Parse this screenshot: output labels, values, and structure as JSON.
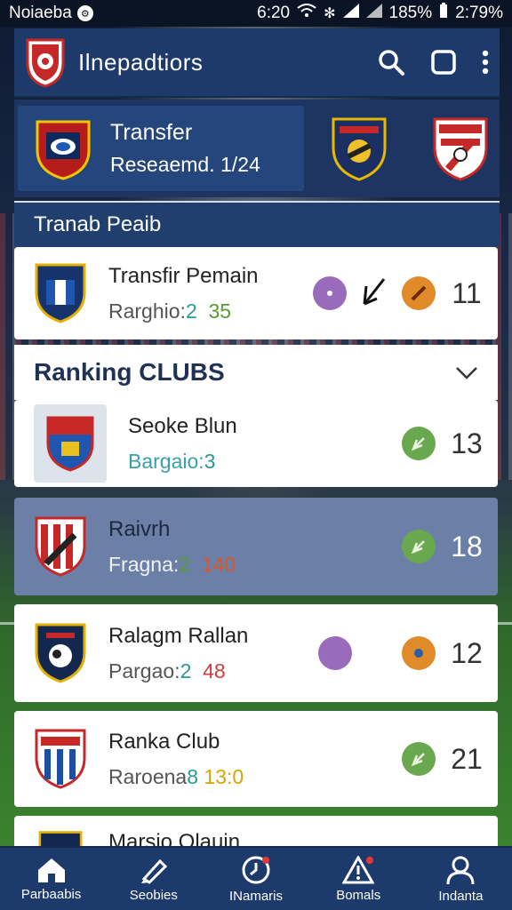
{
  "status_bar": {
    "carrier": "Noiaeba",
    "time": "6:20",
    "battery": "185%",
    "clock2": "2:79%"
  },
  "app_bar": {
    "title": "Ilnepadtiors",
    "icons": [
      "search-icon",
      "square-icon",
      "more-vert-icon"
    ]
  },
  "banner": {
    "title": "Transfer",
    "subtitle": "Reseaemd. 1/24"
  },
  "section": {
    "title": "Tranab Peaib"
  },
  "transfer_item": {
    "name": "Transfir Pemain",
    "sub_prefix": "Rarghio:",
    "sub_num1": "2",
    "sub_num2": "35",
    "rank": "11"
  },
  "ranking": {
    "title": "Ranking CLUBS",
    "items": [
      {
        "name": "Seoke Blun",
        "sub_prefix": "Bargaio:",
        "sub_num1": "3",
        "sub_num2": "",
        "rank": "13",
        "highlighted": false
      },
      {
        "name": "Raivrh",
        "sub_prefix": "Fragna:",
        "sub_num1": "2",
        "sub_num2": "140",
        "rank": "18",
        "highlighted": true
      },
      {
        "name": "Ralagm Rallan",
        "sub_prefix": "Pargao:",
        "sub_num1": "2",
        "sub_num2": "48",
        "rank": "12",
        "highlighted": false
      },
      {
        "name": "Ranka Club",
        "sub_prefix": "Raroena",
        "sub_num1": "8",
        "sub_num2": "13:0",
        "rank": "21",
        "highlighted": false
      },
      {
        "name": "Marsio Olauin",
        "sub_prefix": "",
        "sub_num1": "",
        "sub_num2": "",
        "rank": "",
        "highlighted": false
      }
    ]
  },
  "bottom_nav": {
    "tabs": [
      {
        "label": "Parbaabis",
        "icon": "home-icon"
      },
      {
        "label": "Seobies",
        "icon": "pen-icon"
      },
      {
        "label": "INamaris",
        "icon": "clock-icon"
      },
      {
        "label": "Bomals",
        "icon": "alert-icon"
      },
      {
        "label": "Indanta",
        "icon": "user-icon"
      }
    ]
  },
  "colors": {
    "app_bar": "#1d3a6a",
    "highlight_row": "#6c7fa6",
    "badge_green": "#6aa84f",
    "badge_orange": "#e08a2a",
    "purple": "#9a6bbb"
  }
}
